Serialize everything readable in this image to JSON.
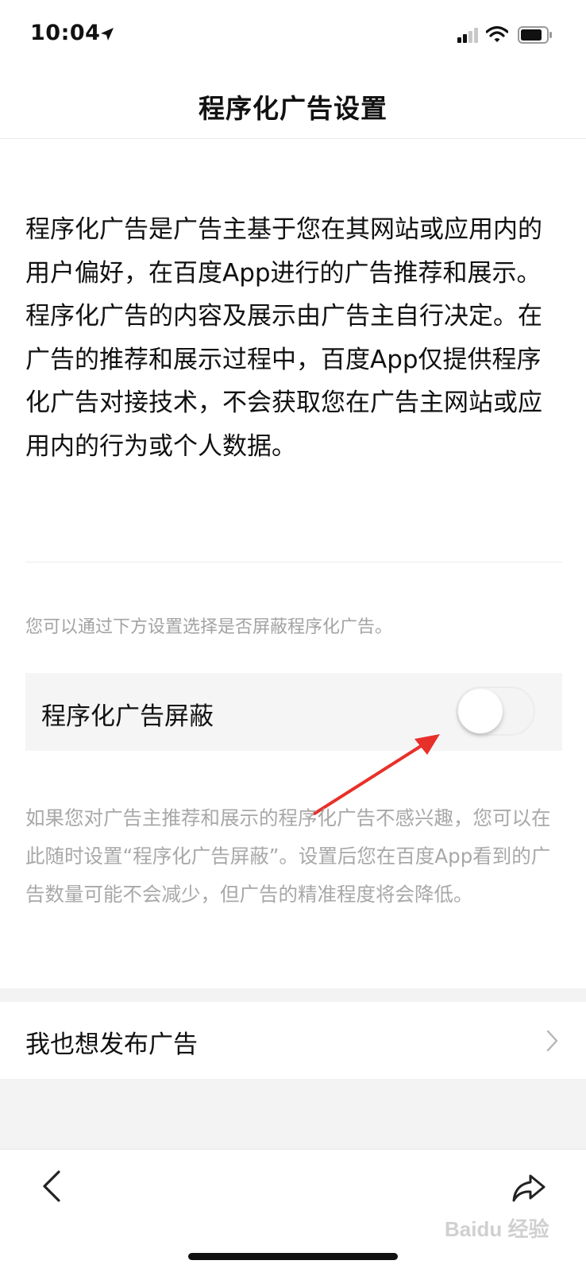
{
  "status_bar": {
    "time": "10:04",
    "icons": [
      "location-arrow-icon",
      "cellular-signal-icon",
      "wifi-icon",
      "battery-icon"
    ]
  },
  "nav": {
    "title": "程序化广告设置"
  },
  "intro": {
    "text": "程序化广告是广告主基于您在其网站或应用内的用户偏好，在百度App进行的广告推荐和展示。程序化广告的内容及展示由广告主自行决定。在广告的推荐和展示过程中，百度App仅提供程序化广告对接技术，不会获取您在广告主网站或应用内的行为或个人数据。"
  },
  "setting": {
    "hint": "您可以通过下方设置选择是否屏蔽程序化广告。",
    "label": "程序化广告屏蔽",
    "enabled": false,
    "description": "如果您对广告主推荐和展示的程序化广告不感兴趣，您可以在此随时设置“程序化广告屏蔽”。设置后您在百度App看到的广告数量可能不会减少，但广告的精准程度将会降低。"
  },
  "publish": {
    "label": "我也想发布广告"
  },
  "toolbar": {
    "icons": [
      "back-arrow-icon",
      "share-icon"
    ]
  },
  "watermark": {
    "text": "Baidu 经验"
  },
  "colors": {
    "text_primary": "#111111",
    "text_secondary": "#a3a3a3",
    "row_background": "#f6f5f5",
    "annotation_arrow": "#e8302a"
  }
}
